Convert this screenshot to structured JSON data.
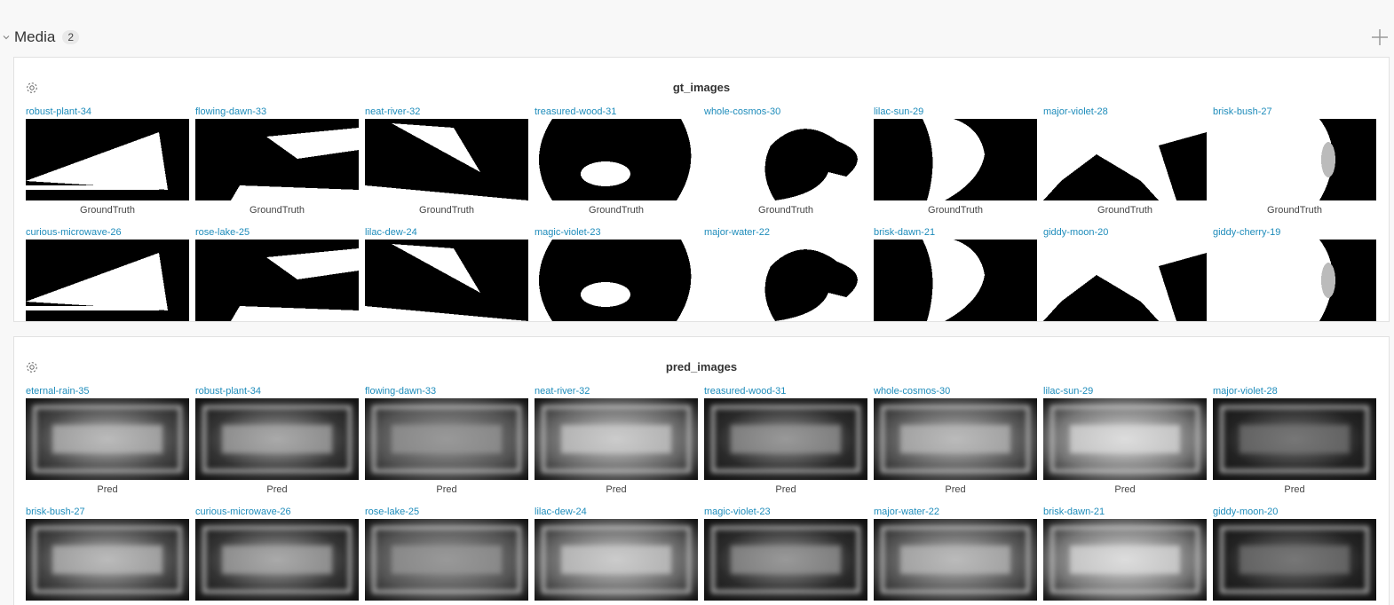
{
  "section": {
    "title": "Media",
    "count": "2",
    "add_icon": "plus-icon",
    "chevron_icon": "chevron-down-icon"
  },
  "panels": [
    {
      "title": "gt_images",
      "gear_icon": "gear-icon",
      "rows": [
        {
          "caption": "GroundTruth",
          "items": [
            {
              "name": "robust-plant-34",
              "style": "bin"
            },
            {
              "name": "flowing-dawn-33",
              "style": "bin"
            },
            {
              "name": "neat-river-32",
              "style": "bin"
            },
            {
              "name": "treasured-wood-31",
              "style": "bin"
            },
            {
              "name": "whole-cosmos-30",
              "style": "bin"
            },
            {
              "name": "lilac-sun-29",
              "style": "bin"
            },
            {
              "name": "major-violet-28",
              "style": "bin"
            },
            {
              "name": "brisk-bush-27",
              "style": "bin"
            }
          ]
        },
        {
          "caption": "",
          "items": [
            {
              "name": "curious-microwave-26",
              "style": "bin"
            },
            {
              "name": "rose-lake-25",
              "style": "bin"
            },
            {
              "name": "lilac-dew-24",
              "style": "bin"
            },
            {
              "name": "magic-violet-23",
              "style": "bin"
            },
            {
              "name": "major-water-22",
              "style": "bin"
            },
            {
              "name": "brisk-dawn-21",
              "style": "bin"
            },
            {
              "name": "giddy-moon-20",
              "style": "bin"
            },
            {
              "name": "giddy-cherry-19",
              "style": "bin"
            }
          ]
        }
      ]
    },
    {
      "title": "pred_images",
      "gear_icon": "gear-icon",
      "rows": [
        {
          "caption": "Pred",
          "items": [
            {
              "name": "eternal-rain-35",
              "style": "blur"
            },
            {
              "name": "robust-plant-34",
              "style": "blur"
            },
            {
              "name": "flowing-dawn-33",
              "style": "blur"
            },
            {
              "name": "neat-river-32",
              "style": "blur"
            },
            {
              "name": "treasured-wood-31",
              "style": "blur"
            },
            {
              "name": "whole-cosmos-30",
              "style": "blur"
            },
            {
              "name": "lilac-sun-29",
              "style": "blur"
            },
            {
              "name": "major-violet-28",
              "style": "blur"
            }
          ]
        },
        {
          "caption": "",
          "items": [
            {
              "name": "brisk-bush-27",
              "style": "blur"
            },
            {
              "name": "curious-microwave-26",
              "style": "blur"
            },
            {
              "name": "rose-lake-25",
              "style": "blur"
            },
            {
              "name": "lilac-dew-24",
              "style": "blur"
            },
            {
              "name": "magic-violet-23",
              "style": "blur"
            },
            {
              "name": "major-water-22",
              "style": "blur"
            },
            {
              "name": "brisk-dawn-21",
              "style": "blur"
            },
            {
              "name": "giddy-moon-20",
              "style": "blur"
            }
          ]
        }
      ]
    }
  ],
  "colors": {
    "link": "#1e8cbb",
    "panel_border": "#e2e2e2",
    "page_bg": "#f8f8f8"
  }
}
